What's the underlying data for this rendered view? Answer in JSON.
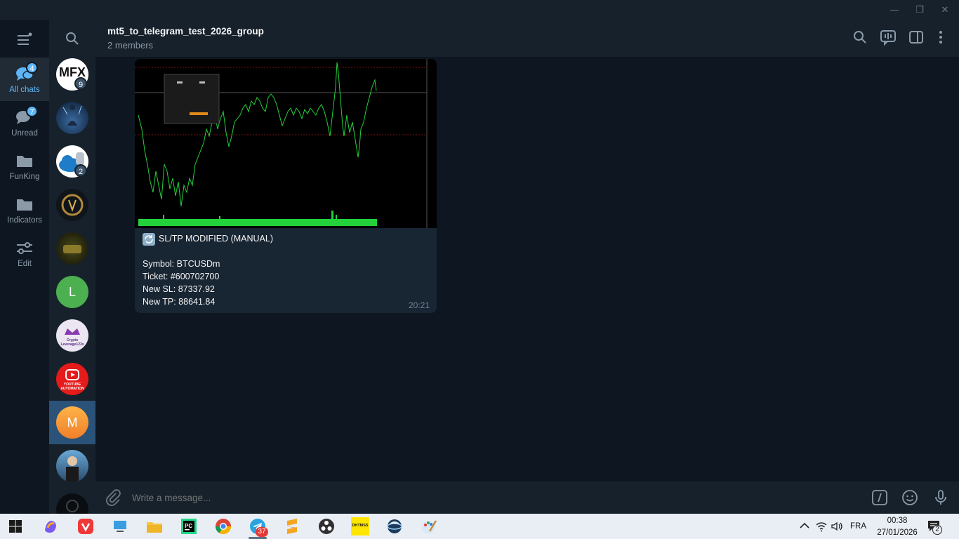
{
  "window": {
    "minimize": "—",
    "restore": "❐",
    "close": "✕"
  },
  "folders": [
    {
      "label": "All chats",
      "badge": "4"
    },
    {
      "label": "Unread",
      "badge": "7"
    },
    {
      "label": "FunKing"
    },
    {
      "label": "Indicators"
    },
    {
      "label": "Edit"
    }
  ],
  "chats": [
    {
      "initial": "MFX",
      "badge": "9"
    },
    {
      "initial": ""
    },
    {
      "initial": "",
      "badge": "2"
    },
    {
      "initial": ""
    },
    {
      "initial": ""
    },
    {
      "initial": "L"
    },
    {
      "initial": "",
      "text": "Crypto Leverage123x"
    },
    {
      "initial": "",
      "text": "YOUTUBE AUTOMATION"
    },
    {
      "initial": "M"
    },
    {
      "initial": ""
    },
    {
      "initial": ""
    }
  ],
  "header": {
    "title": "mt5_to_telegram_test_2026_group",
    "subtitle": "2 members"
  },
  "message": {
    "heading": "SL/TP MODIFIED (MANUAL)",
    "symbol": "Symbol: BTCUSDm",
    "ticket": "Ticket: #600702700",
    "new_sl": "New SL: 87337.92",
    "new_tp": "New TP: 88641.84",
    "time": "20:21"
  },
  "composer": {
    "placeholder": "Write a message..."
  },
  "taskbar": {
    "telegram_badge": "37",
    "lang": "FRA",
    "time": "00:38",
    "date": "27/01/2026",
    "notifications": "2",
    "app_label": "DHTMSS"
  },
  "colors": {
    "accent": "#5eb5f7",
    "chart_green": "#23d13a",
    "bg": "#0e1621",
    "panel": "#17212b"
  }
}
